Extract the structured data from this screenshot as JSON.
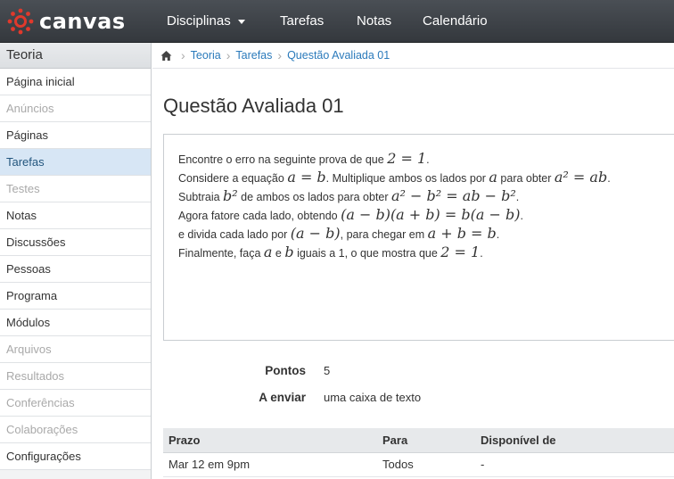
{
  "header": {
    "logo_text": "canvas",
    "nav": {
      "disciplinas": "Disciplinas",
      "tarefas": "Tarefas",
      "notas": "Notas",
      "calendario": "Calendário"
    }
  },
  "sidebar": {
    "course_title": "Teoria",
    "items": [
      {
        "label": "Página inicial"
      },
      {
        "label": "Anúncios"
      },
      {
        "label": "Páginas"
      },
      {
        "label": "Tarefas"
      },
      {
        "label": "Testes"
      },
      {
        "label": "Notas"
      },
      {
        "label": "Discussões"
      },
      {
        "label": "Pessoas"
      },
      {
        "label": "Programa"
      },
      {
        "label": "Módulos"
      },
      {
        "label": "Arquivos"
      },
      {
        "label": "Resultados"
      },
      {
        "label": "Conferências"
      },
      {
        "label": "Colaborações"
      },
      {
        "label": "Configurações"
      }
    ]
  },
  "breadcrumb": {
    "items": [
      "Teoria",
      "Tarefas",
      "Questão Avaliada 01"
    ]
  },
  "assignment": {
    "title": "Questão Avaliada 01",
    "description": {
      "l1_text": "Encontre o erro na seguinte prova de que ",
      "l1_math": "2 = 1",
      "l1_end": ".",
      "l2_text_a": "Considere a equação ",
      "l2_math_a": "a = b",
      "l2_text_b": ". Multiplique ambos os lados por ",
      "l2_math_b": "a",
      "l2_text_c": " para obter ",
      "l2_math_c": "a² = ab",
      "l2_end": ".",
      "l3_text_a": "Subtraia ",
      "l3_math_a": "b²",
      "l3_text_b": " de ambos os lados para obter ",
      "l3_math_b": "a² − b² = ab − b²",
      "l3_end": ".",
      "l4_text": "Agora fatore cada lado, obtendo ",
      "l4_math": "(a − b)(a + b) = b(a − b)",
      "l4_end": ".",
      "l5_text_a": "e divida cada lado por ",
      "l5_math_a": "(a − b)",
      "l5_text_b": ", para chegar em ",
      "l5_math_b": "a + b = b",
      "l5_end": ".",
      "l6_text_a": "Finalmente, faça ",
      "l6_math_a": "a",
      "l6_text_b": " e ",
      "l6_math_b": "b",
      "l6_text_c": " iguais a 1, o que mostra que ",
      "l6_math_c": "2 = 1",
      "l6_end": "."
    },
    "details": {
      "points_label": "Pontos",
      "points_value": "5",
      "submit_label": "A enviar",
      "submit_value": "uma caixa de texto"
    },
    "due_table": {
      "headers": [
        "Prazo",
        "Para",
        "Disponível de"
      ],
      "rows": [
        [
          "Mar 12 em 9pm",
          "Todos",
          "-"
        ]
      ]
    }
  },
  "colors": {
    "header_bg": "#3c4146",
    "logo_red": "#e0392c",
    "link": "#2a7abb",
    "active_item_bg": "#d7e6f5"
  }
}
